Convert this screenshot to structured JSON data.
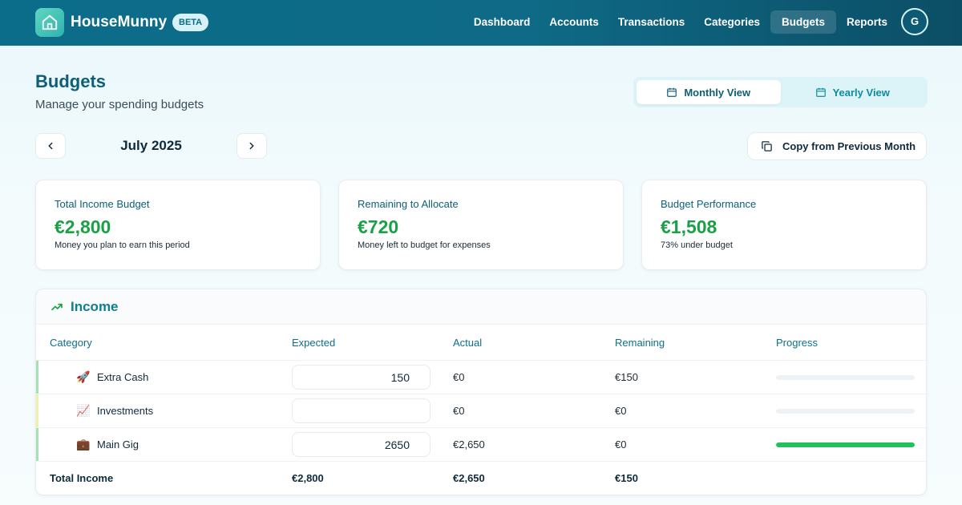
{
  "nav": {
    "brand": "HouseMunny",
    "beta": "BETA",
    "links": [
      "Dashboard",
      "Accounts",
      "Transactions",
      "Categories",
      "Budgets",
      "Reports"
    ],
    "active": "Budgets",
    "avatar_initial": "G"
  },
  "header": {
    "title": "Budgets",
    "subtitle": "Manage your spending budgets",
    "view_monthly": "Monthly View",
    "view_yearly": "Yearly View",
    "active_view": "Monthly View"
  },
  "period": {
    "month": "July 2025",
    "copy_button": "Copy from Previous Month"
  },
  "cards": [
    {
      "title": "Total Income Budget",
      "value": "€2,800",
      "sub": "Money you plan to earn this period"
    },
    {
      "title": "Remaining to Allocate",
      "value": "€720",
      "sub": "Money left to budget for expenses"
    },
    {
      "title": "Budget Performance",
      "value": "€1,508",
      "sub": "73% under budget"
    }
  ],
  "income": {
    "section_title": "Income",
    "columns": [
      "Category",
      "Expected",
      "Actual",
      "Remaining",
      "Progress"
    ],
    "rows": [
      {
        "icon": "🚀",
        "name": "Extra Cash",
        "expected": "150",
        "actual": "€0",
        "remaining": "€150",
        "progress": 0,
        "bar_color": "#a8e0b6"
      },
      {
        "icon": "📈",
        "name": "Investments",
        "expected": "",
        "actual": "€0",
        "remaining": "€0",
        "progress": 0,
        "bar_color": "#eef2a8"
      },
      {
        "icon": "💼",
        "name": "Main Gig",
        "expected": "2650",
        "actual": "€2,650",
        "remaining": "€0",
        "progress": 1,
        "bar_color": "#a8e0b6"
      }
    ],
    "total": {
      "label": "Total Income",
      "expected": "€2,800",
      "actual": "€2,650",
      "remaining": "€150"
    }
  },
  "colors": {
    "nav_bg": "#0b6d8a",
    "accent": "#0d5f78",
    "positive": "#1aa047",
    "progress_fill": "#22c15e"
  }
}
